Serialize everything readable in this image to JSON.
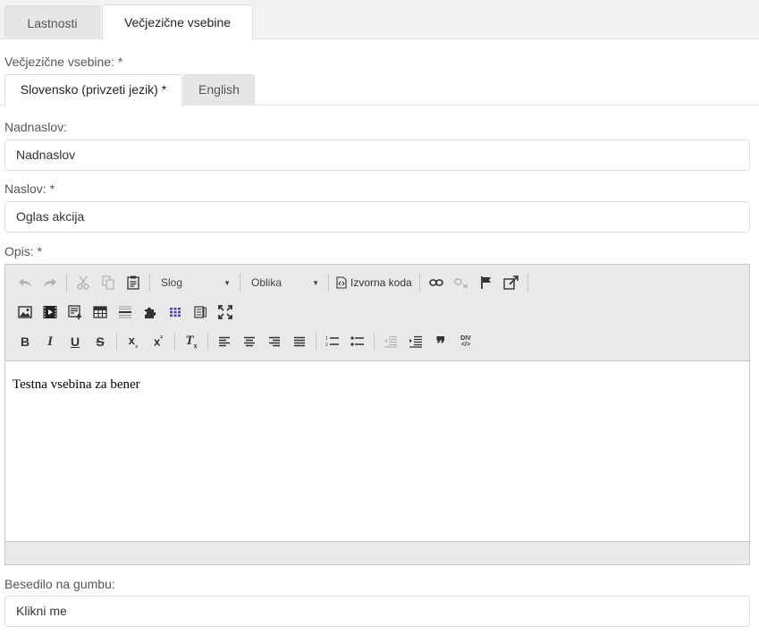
{
  "top_tabs": [
    {
      "label": "Lastnosti",
      "active": false
    },
    {
      "label": "Večjezične vsebine",
      "active": true
    }
  ],
  "multilang_label": "Večjezične vsebine: *",
  "lang_tabs": [
    {
      "label": "Slovensko (privzeti jezik) *",
      "active": true
    },
    {
      "label": "English",
      "active": false
    }
  ],
  "fields": {
    "subtitle": {
      "label": "Nadnaslov:",
      "value": "Nadnaslov"
    },
    "title": {
      "label": "Naslov: *",
      "value": "Oglas akcija"
    },
    "description": {
      "label": "Opis: *"
    },
    "button_text": {
      "label": "Besedilo na gumbu:",
      "value": "Klikni me"
    }
  },
  "editor": {
    "style_combo": "Slog",
    "format_combo": "Oblika",
    "source_label": "Izvorna koda",
    "content": "Testna vsebina za bener",
    "icons": {
      "bold": "B",
      "italic": "I",
      "underline": "U",
      "strike": "S",
      "subscript": "x",
      "subscript_mark": "₂",
      "superscript": "x",
      "superscript_mark": "²",
      "remove_format": "T",
      "remove_format_mark": "x",
      "blockquote": "❞",
      "div_top": "DIV",
      "div_bottom": "</>"
    }
  },
  "colors": {
    "toolbar_bg": "#e9e9e9",
    "tab_inactive_bg": "#e6e6e6",
    "border": "#e0e0e0",
    "plugin_purple": "#5b3fa0"
  }
}
